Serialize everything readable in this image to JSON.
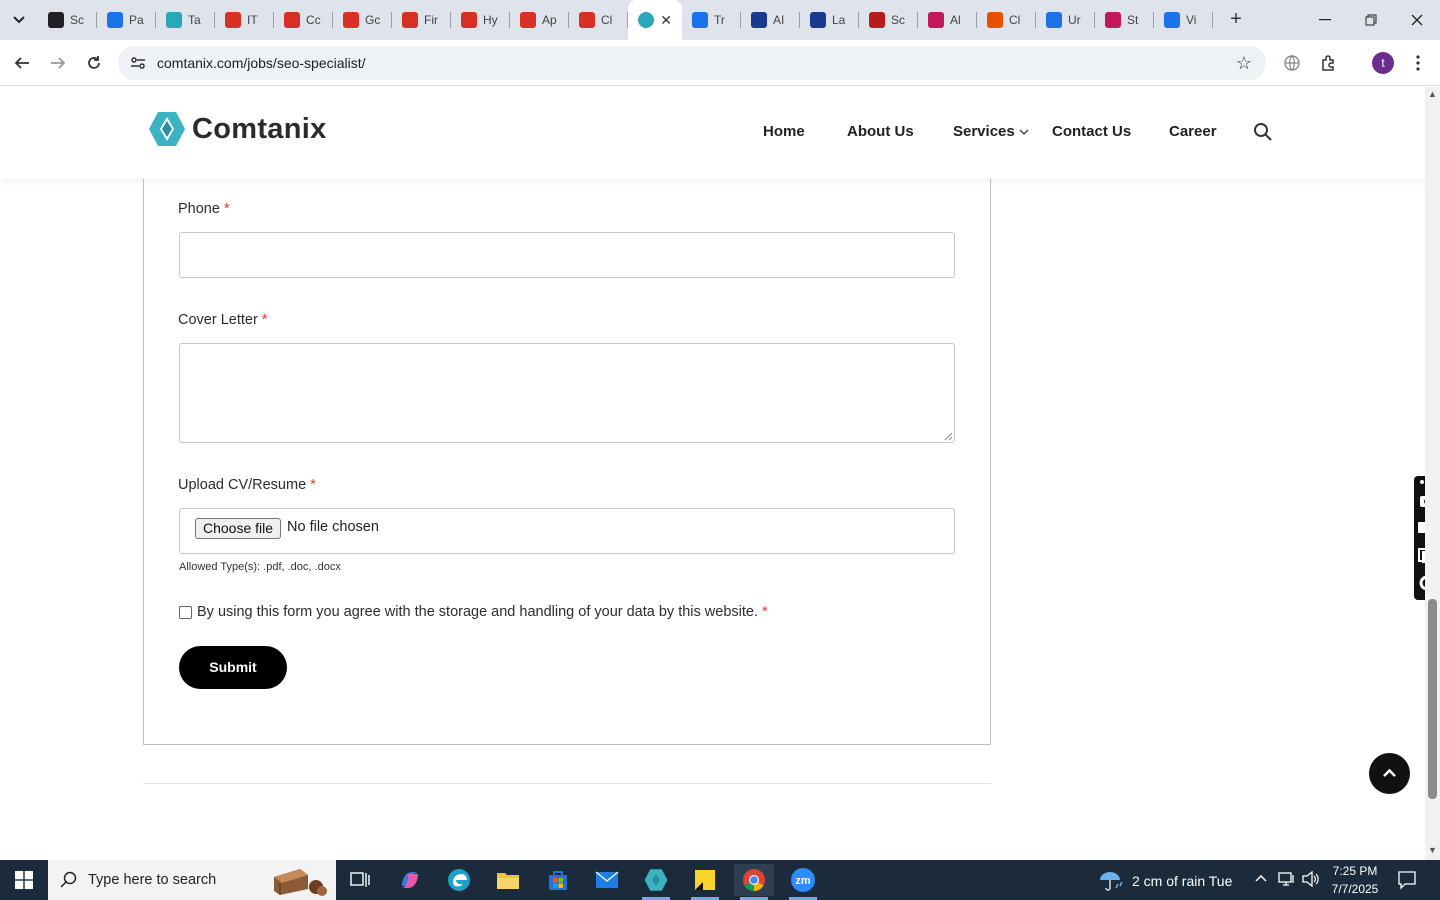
{
  "browser": {
    "tabs": [
      {
        "title": "Sc",
        "icon": "settings-gear-icon",
        "color": "#202124"
      },
      {
        "title": "Pa",
        "icon": "gauge-icon",
        "color": "#1a73e8"
      },
      {
        "title": "Ta",
        "icon": "comtanix-icon",
        "color": "#2aa7b8"
      },
      {
        "title": "IT",
        "icon": "diamond-red-icon",
        "color": "#d93025"
      },
      {
        "title": "Cc",
        "icon": "diamond-red-icon",
        "color": "#d93025"
      },
      {
        "title": "Gc",
        "icon": "diamond-red-icon",
        "color": "#d93025"
      },
      {
        "title": "Fir",
        "icon": "diamond-red-icon",
        "color": "#d93025"
      },
      {
        "title": "Hy",
        "icon": "diamond-red-icon",
        "color": "#d93025"
      },
      {
        "title": "Ap",
        "icon": "diamond-red-icon",
        "color": "#d93025"
      },
      {
        "title": "Cl",
        "icon": "diamond-red-icon",
        "color": "#d93025"
      },
      {
        "title": "",
        "icon": "comtanix-icon",
        "color": "#2aa7b8",
        "active": true
      },
      {
        "title": "Tr",
        "icon": "scales-icon",
        "color": "#1a73e8"
      },
      {
        "title": "AI",
        "icon": "x-logo-icon",
        "color": "#1a3a8f"
      },
      {
        "title": "La",
        "icon": "check-wing-icon",
        "color": "#1a3a8f"
      },
      {
        "title": "Sc",
        "icon": "v-logo-icon",
        "color": "#b71c1c"
      },
      {
        "title": "Al",
        "icon": "pinwheel-icon",
        "color": "#c2185b"
      },
      {
        "title": "Cl",
        "icon": "swoosh-icon",
        "color": "#e65100"
      },
      {
        "title": "Ur",
        "icon": "doc-icon",
        "color": "#1a73e8"
      },
      {
        "title": "St",
        "icon": "pen-icon",
        "color": "#c2185b"
      },
      {
        "title": "Vi",
        "icon": "pulse-icon",
        "color": "#1a73e8"
      }
    ],
    "url": "comtanix.com/jobs/seo-specialist/",
    "profile_initial": "t"
  },
  "site": {
    "brand": "Comtanix",
    "brand_color": "#3bb3c3",
    "nav": {
      "home": "Home",
      "about": "About Us",
      "services": "Services",
      "contact": "Contact Us",
      "career": "Career"
    }
  },
  "form": {
    "phone_label": "Phone",
    "cover_label": "Cover Letter",
    "upload_label": "Upload CV/Resume",
    "required_mark": "*",
    "phone_value": "",
    "cover_value": "",
    "choose_file": "Choose file",
    "no_file": "No file chosen",
    "allowed_types": "Allowed Type(s): .pdf, .doc, .docx",
    "consent": "By using this form you agree with the storage and handling of your data by this website.",
    "submit": "Submit"
  },
  "taskbar": {
    "search_placeholder": "Type here to search",
    "weather": "2 cm of rain Tue",
    "time": "7:25 PM",
    "date": "7/7/2025"
  }
}
